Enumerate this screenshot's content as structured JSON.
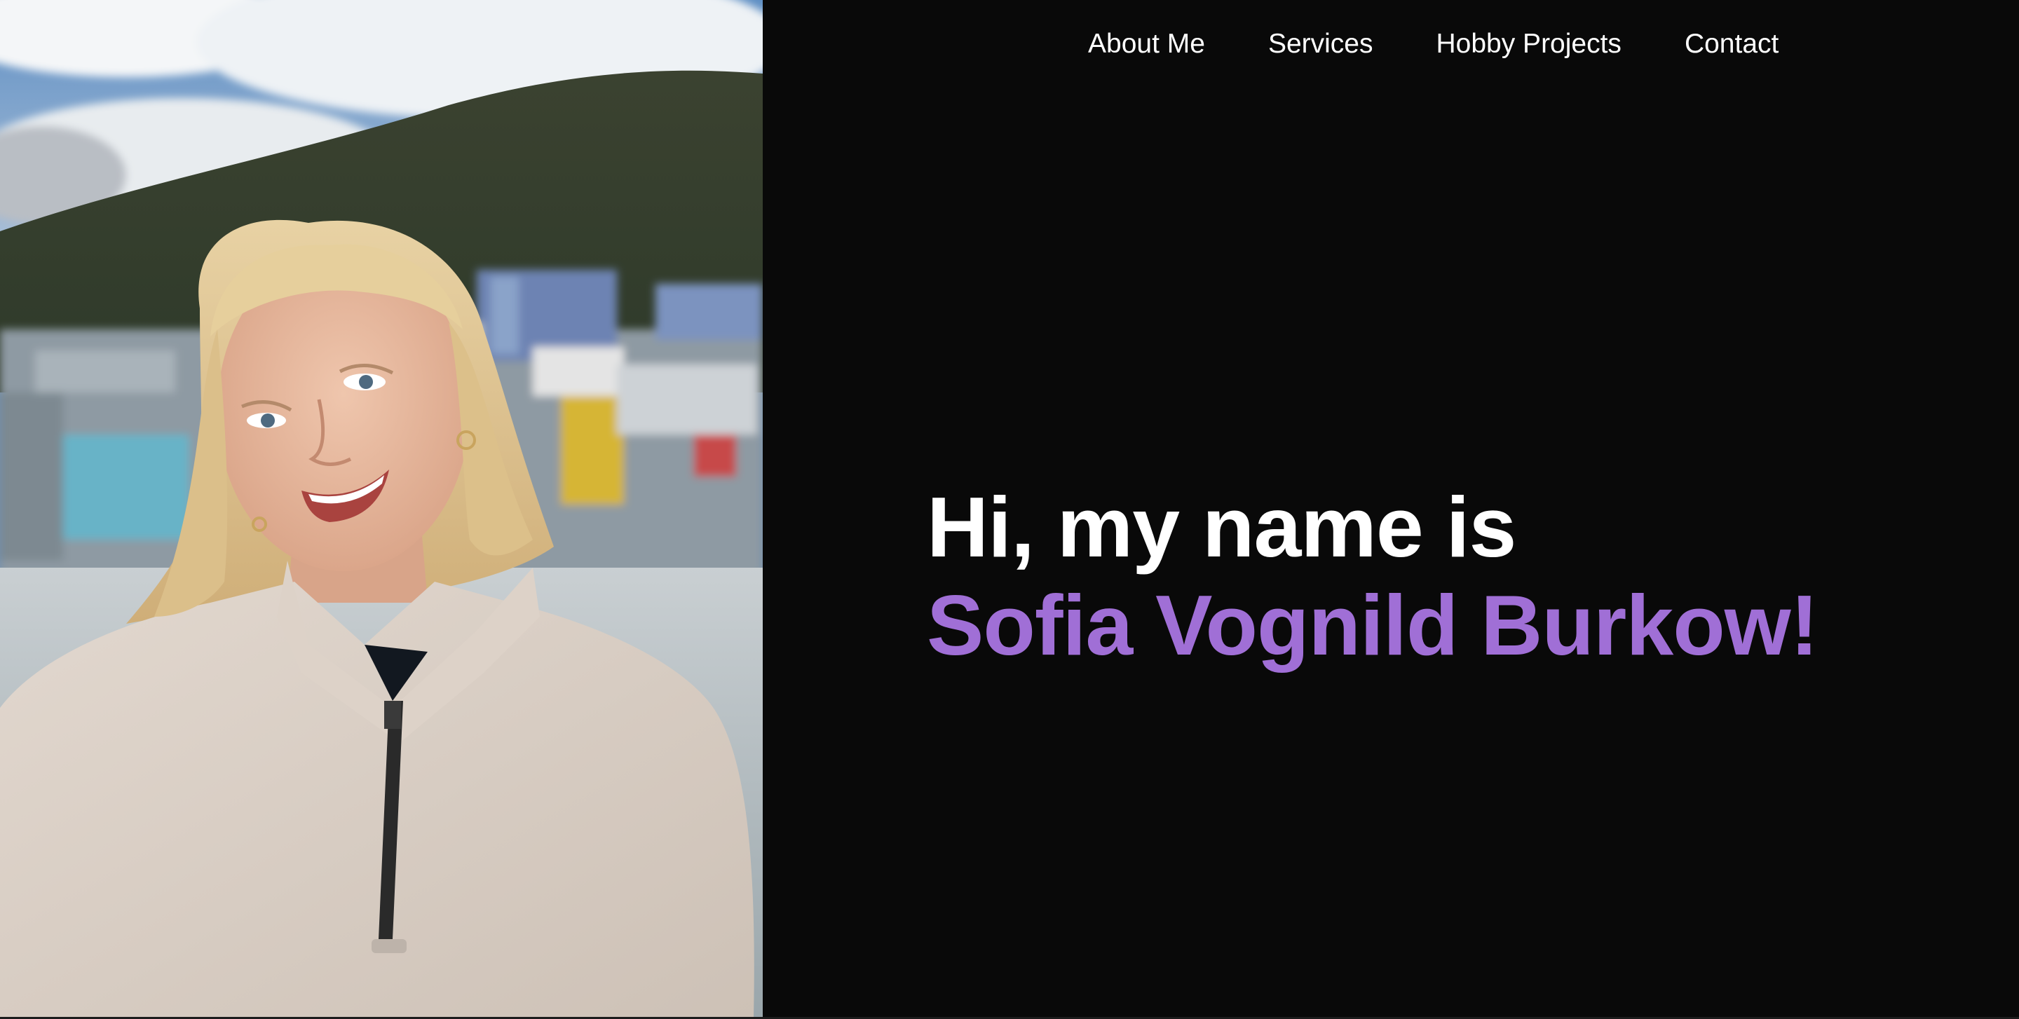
{
  "nav": {
    "items": [
      {
        "label": "About Me"
      },
      {
        "label": "Services"
      },
      {
        "label": "Hobby Projects"
      },
      {
        "label": "Contact"
      }
    ]
  },
  "hero": {
    "greeting": "Hi, my name is",
    "name": "Sofia Vognild Burkow!"
  },
  "colors": {
    "background": "#090909",
    "text": "#ffffff",
    "accent": "#a06fd6"
  },
  "photo": {
    "subject": "portrait-photo"
  }
}
